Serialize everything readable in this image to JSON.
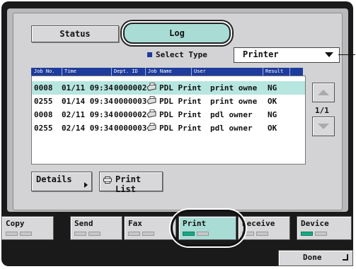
{
  "tabs_top": {
    "status_label": "Status",
    "log_label": "Log"
  },
  "select_type": {
    "label": "Select Type",
    "value": "Printer"
  },
  "table": {
    "headers": [
      "Job No.",
      "Time",
      "Dept. ID",
      "Job Name",
      "User",
      "Result"
    ],
    "rows": [
      {
        "job_no": "0008",
        "time": "01/11 09:34",
        "dept_id": "0000002",
        "job_name": "PDL Print",
        "user": "print owne",
        "result": "NG"
      },
      {
        "job_no": "0255",
        "time": "01/14 09:34",
        "dept_id": "0000003",
        "job_name": "PDL Print",
        "user": "print owne",
        "result": "OK"
      },
      {
        "job_no": "0008",
        "time": "02/11 09:34",
        "dept_id": "0000002",
        "job_name": "PDL Print",
        "user": "pdl owner",
        "result": "NG"
      },
      {
        "job_no": "0255",
        "time": "02/14 09:34",
        "dept_id": "0000003",
        "job_name": "PDL Print",
        "user": "pdl owner",
        "result": "OK"
      }
    ]
  },
  "pager": {
    "page": "1/1"
  },
  "actions": {
    "details_label": "Details",
    "print_list_label": "Print List"
  },
  "bottom_tabs": [
    {
      "label": "Copy"
    },
    {
      "label": "Send"
    },
    {
      "label": "Fax"
    },
    {
      "label": "Print"
    },
    {
      "label": "Receive"
    },
    {
      "label": "Device"
    }
  ],
  "done_label": "Done",
  "colors": {
    "accent": "#a9dcd4",
    "header_blue": "#1e3c9c",
    "led_green": "#1aa883"
  }
}
